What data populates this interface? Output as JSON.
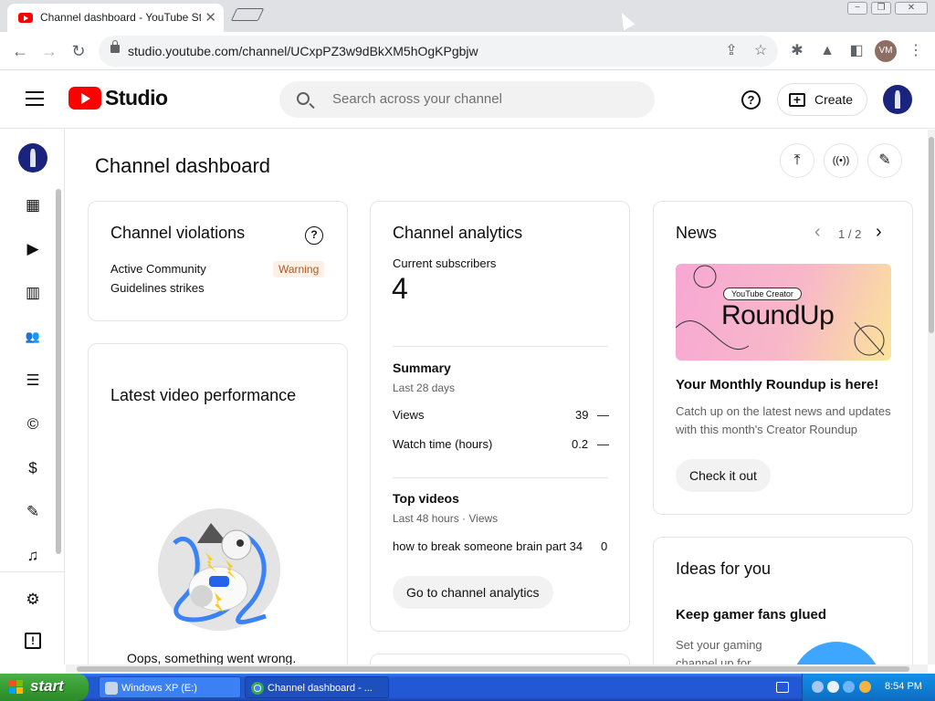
{
  "browser": {
    "tab_title": "Channel dashboard - YouTube Studio",
    "tab_close": "✕",
    "url": "studio.youtube.com/channel/UCxpPZ3w9dBkXM5hOgKPgbjw",
    "profile_initials": "VM",
    "window_controls": [
      "−",
      "❐",
      "✕"
    ]
  },
  "header": {
    "logo": "Studio",
    "search_placeholder": "Search across your channel",
    "help": "?",
    "create_label": "Create"
  },
  "sidebar": {
    "items": [
      {
        "icon": "dashboard-icon",
        "glyph": "▦"
      },
      {
        "icon": "content-icon",
        "glyph": "▶"
      },
      {
        "icon": "analytics-icon",
        "glyph": "▥"
      },
      {
        "icon": "community-icon",
        "glyph": "👥"
      },
      {
        "icon": "subtitles-icon",
        "glyph": "☰"
      },
      {
        "icon": "copyright-icon",
        "glyph": "©"
      },
      {
        "icon": "earn-icon",
        "glyph": "$"
      },
      {
        "icon": "customization-icon",
        "glyph": "✎"
      },
      {
        "icon": "audio-library-icon",
        "glyph": "♫"
      },
      {
        "icon": "settings-icon",
        "glyph": "⚙"
      },
      {
        "icon": "feedback-icon",
        "glyph": "!"
      }
    ]
  },
  "main": {
    "title": "Channel dashboard",
    "actions": [
      {
        "icon": "upload-icon",
        "glyph": "⤒"
      },
      {
        "icon": "go-live-icon",
        "glyph": "((•))"
      },
      {
        "icon": "create-post-icon",
        "glyph": "✎"
      }
    ]
  },
  "violations": {
    "title": "Channel violations",
    "help": "?",
    "label_line1": "Active Community",
    "label_line2": "Guidelines strikes",
    "status": "Warning"
  },
  "latest_video": {
    "title": "Latest video performance",
    "error": "Oops, something went wrong."
  },
  "analytics": {
    "title": "Channel analytics",
    "subscribers_label": "Current subscribers",
    "subscribers_value": "4",
    "summary_title": "Summary",
    "summary_period": "Last 28 days",
    "metrics": [
      {
        "label": "Views",
        "value": "39",
        "trend": "—"
      },
      {
        "label": "Watch time (hours)",
        "value": "0.2",
        "trend": "—"
      }
    ],
    "top_title": "Top videos",
    "top_period": "Last 48 hours · Views",
    "top_videos": [
      {
        "title": "how to break someone brain part 34",
        "views": "0"
      }
    ],
    "button": "Go to channel analytics"
  },
  "news": {
    "title": "News",
    "pager": "1 / 2",
    "prev": "‹",
    "next": "›",
    "banner_tag": "YouTube Creator",
    "banner_title": "RoundUp",
    "headline": "Your Monthly Roundup is here!",
    "body": "Catch up on the latest news and updates with this month's Creator Roundup",
    "button": "Check it out"
  },
  "ideas": {
    "title": "Ideas for you",
    "headline": "Keep gamer fans glued",
    "body": "Set your gaming channel up for"
  },
  "taskbar": {
    "start": "start",
    "tasks": [
      "Windows XP (E:)",
      "Channel dashboard - ..."
    ],
    "clock": "8:54 PM"
  },
  "colors": {
    "brand_red": "#ff0000",
    "warning_bg": "#fdf1e6",
    "warning_text": "#b3541e",
    "xp_blue": "#2358d4",
    "xp_green": "#379d33"
  }
}
